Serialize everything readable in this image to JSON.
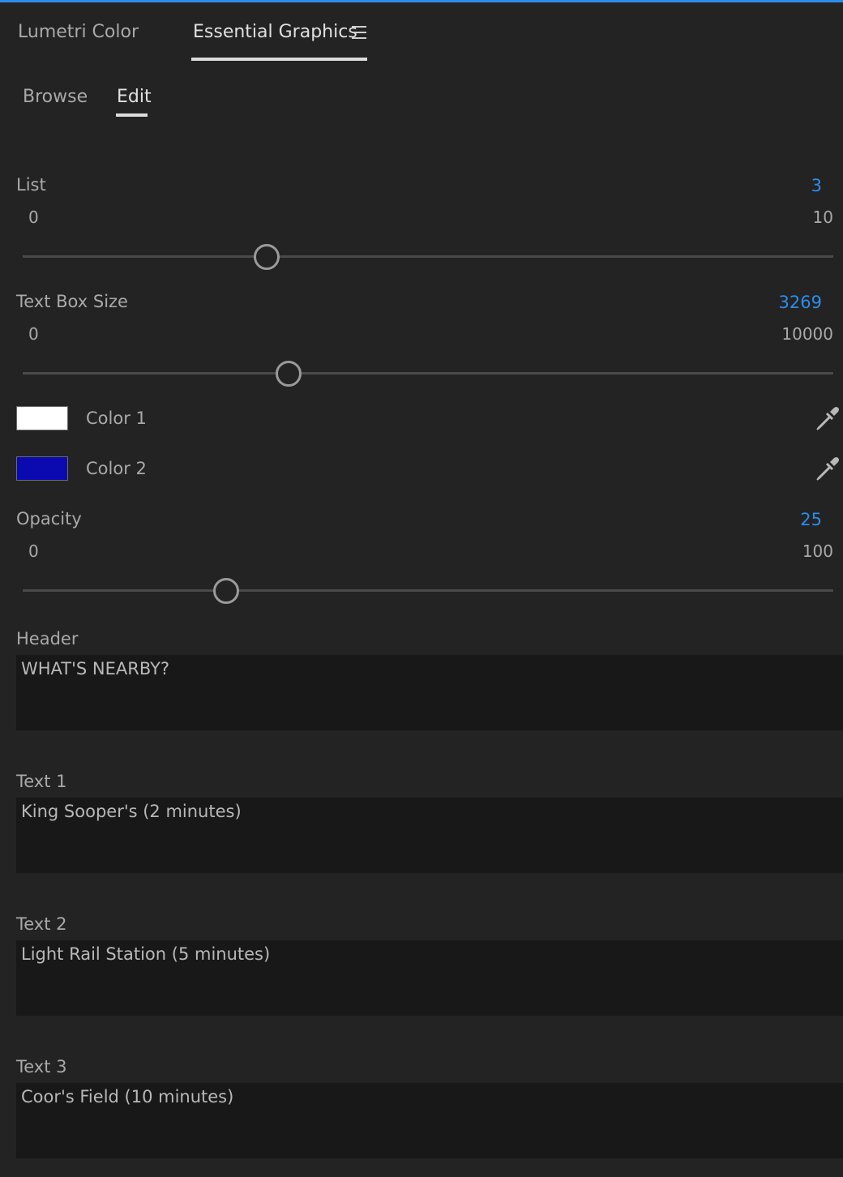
{
  "panel_tabs": {
    "lumetri": "Lumetri Color",
    "essential": "Essential Graphics"
  },
  "sub_tabs": {
    "browse": "Browse",
    "edit": "Edit"
  },
  "controls": {
    "list": {
      "label": "List",
      "value": "3",
      "min": "0",
      "max": "10",
      "level": 0.3
    },
    "text_box_size": {
      "label": "Text Box Size",
      "value": "3269",
      "min": "0",
      "max": "10000",
      "level": 0.3269
    },
    "opacity": {
      "label": "Opacity",
      "value": "25",
      "min": "0",
      "max": "100",
      "level": 0.25
    }
  },
  "colors": {
    "color1": {
      "label": "Color 1",
      "swatch": "#ffffff"
    },
    "color2": {
      "label": "Color 2",
      "swatch": "#0a0ab0"
    },
    "accent": "#2d8ceb"
  },
  "fields": {
    "header": {
      "label": "Header",
      "value": "WHAT'S NEARBY?"
    },
    "text1": {
      "label": "Text 1",
      "value": "King Sooper's (2 minutes)"
    },
    "text2": {
      "label": "Text 2",
      "value": "Light Rail Station (5 minutes)"
    },
    "text3": {
      "label": "Text 3",
      "value": "Coor's Field (10 minutes)"
    }
  },
  "icons": {
    "menu": "hamburger-menu-icon",
    "eyedropper": "eyedropper-icon"
  }
}
